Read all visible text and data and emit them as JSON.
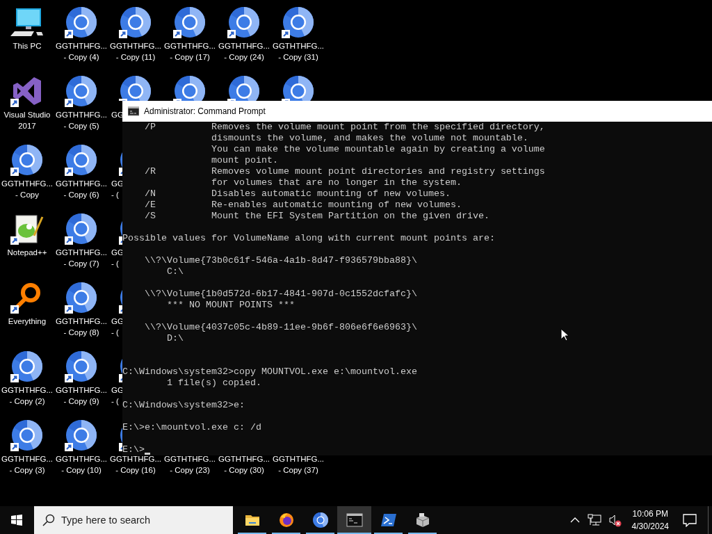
{
  "desktop": {
    "columns": [
      [
        {
          "kind": "pc",
          "lines": [
            "This PC"
          ]
        },
        {
          "kind": "vs",
          "lines": [
            "Visual Studio",
            "2017"
          ]
        },
        {
          "kind": "ring",
          "lines": [
            "GGTHTHFG...",
            "- Copy"
          ]
        },
        {
          "kind": "notepad",
          "lines": [
            "Notepad++"
          ]
        },
        {
          "kind": "everything",
          "lines": [
            "Everything"
          ]
        },
        {
          "kind": "ring",
          "lines": [
            "GGTHTHFG...",
            "- Copy (2)"
          ]
        },
        {
          "kind": "ring",
          "lines": [
            "GGTHTHFG...",
            "- Copy (3)"
          ]
        }
      ],
      [
        {
          "kind": "ring",
          "lines": [
            "GGTHTHFG...",
            "- Copy (4)"
          ]
        },
        {
          "kind": "ring",
          "lines": [
            "GGTHTHFG...",
            "- Copy (5)"
          ]
        },
        {
          "kind": "ring",
          "lines": [
            "GGTHTHFG...",
            "- Copy (6)"
          ]
        },
        {
          "kind": "ring",
          "lines": [
            "GGTHTHFG...",
            "- Copy (7)"
          ]
        },
        {
          "kind": "ring",
          "lines": [
            "GGTHTHFG...",
            "- Copy (8)"
          ]
        },
        {
          "kind": "ring",
          "lines": [
            "GGTHTHFG...",
            "- Copy (9)"
          ]
        },
        {
          "kind": "ring",
          "lines": [
            "GGTHTHFG...",
            "- Copy (10)"
          ]
        }
      ],
      [
        {
          "kind": "ring",
          "lines": [
            "GGTHTHFG...",
            "- Copy (11)"
          ]
        },
        {
          "kind": "ring",
          "lines": [
            "GG"
          ],
          "partial": true
        },
        {
          "kind": "ring",
          "lines": [
            "GG",
            "- ("
          ],
          "partial": true
        },
        {
          "kind": "ring",
          "lines": [
            "GG",
            "- ("
          ],
          "partial": true
        },
        {
          "kind": "ring",
          "lines": [
            "GG",
            "- ("
          ],
          "partial": true
        },
        {
          "kind": "ring",
          "lines": [
            "GG",
            "- ("
          ],
          "partial": true
        },
        {
          "kind": "ring",
          "lines": [
            "GGTHTHFG...",
            "- Copy (16)"
          ]
        }
      ],
      [
        {
          "kind": "ring",
          "lines": [
            "GGTHTHFG...",
            "- Copy (17)"
          ]
        },
        {
          "kind": "ring"
        },
        {
          "kind": "covered"
        },
        {
          "kind": "covered"
        },
        {
          "kind": "covered"
        },
        {
          "kind": "covered"
        },
        {
          "kind": "label_only",
          "lines": [
            "GGTHTHFG...",
            "- Copy (23)"
          ]
        }
      ],
      [
        {
          "kind": "ring",
          "lines": [
            "GGTHTHFG...",
            "- Copy (24)"
          ]
        },
        {
          "kind": "ring"
        },
        {
          "kind": "covered"
        },
        {
          "kind": "covered"
        },
        {
          "kind": "covered"
        },
        {
          "kind": "covered"
        },
        {
          "kind": "label_only",
          "lines": [
            "GGTHTHFG...",
            "- Copy (30)"
          ]
        }
      ],
      [
        {
          "kind": "ring",
          "lines": [
            "GGTHTHFG...",
            "- Copy (31)"
          ]
        },
        {
          "kind": "ring"
        },
        {
          "kind": "covered"
        },
        {
          "kind": "covered"
        },
        {
          "kind": "covered"
        },
        {
          "kind": "covered"
        },
        {
          "kind": "label_only",
          "lines": [
            "GGTHTHFG...",
            "- Copy (37)"
          ]
        }
      ]
    ]
  },
  "window": {
    "title": "Administrator: Command Prompt",
    "lines": [
      {
        "text": "    /P          Removes the volume mount point from the specified directory,"
      },
      {
        "text": "                dismounts the volume, and makes the volume not mountable."
      },
      {
        "text": "                You can make the volume mountable again by creating a volume"
      },
      {
        "text": "                mount point."
      },
      {
        "text": "    /R          Removes volume mount point directories and registry settings"
      },
      {
        "text": "                for volumes that are no longer in the system."
      },
      {
        "text": "    /N          Disables automatic mounting of new volumes."
      },
      {
        "text": "    /E          Re-enables automatic mounting of new volumes."
      },
      {
        "text": "    /S          Mount the EFI System Partition on the given drive."
      },
      {
        "kind": "blank"
      },
      {
        "text": "Possible values for VolumeName along with current mount points are:"
      },
      {
        "kind": "blank"
      },
      {
        "text": "    \\\\?\\Volume{73b0c61f-546a-4a1b-8d47-f936579bba88}\\"
      },
      {
        "text": "        C:\\"
      },
      {
        "kind": "blank"
      },
      {
        "text": "    \\\\?\\Volume{1b0d572d-6b17-4841-907d-0c1552dcfafc}\\"
      },
      {
        "text": "        *** NO MOUNT POINTS ***"
      },
      {
        "kind": "blank"
      },
      {
        "text": "    \\\\?\\Volume{4037c05c-4b89-11ee-9b6f-806e6f6e6963}\\"
      },
      {
        "text": "        D:\\"
      },
      {
        "kind": "blank"
      },
      {
        "kind": "blank"
      },
      {
        "text": "C:\\Windows\\system32>copy MOUNTVOL.exe e:\\mountvol.exe"
      },
      {
        "text": "        1 file(s) copied."
      },
      {
        "kind": "blank"
      },
      {
        "text": "C:\\Windows\\system32>e:"
      },
      {
        "kind": "blank"
      },
      {
        "text": "E:\\>e:\\mountvol.exe c: /d"
      },
      {
        "kind": "blank"
      },
      {
        "text": "E:\\>",
        "cursor": true
      }
    ]
  },
  "taskbar": {
    "search": {
      "placeholder": "Type here to search"
    },
    "apps": [
      {
        "kind": "folder",
        "running": true,
        "selected": false
      },
      {
        "kind": "firefox",
        "running": true,
        "selected": false
      },
      {
        "kind": "ring",
        "running": true,
        "selected": false
      },
      {
        "kind": "terminal",
        "running": true,
        "selected": true
      },
      {
        "kind": "powershell",
        "running": true,
        "selected": false
      },
      {
        "kind": "package",
        "running": true,
        "selected": false
      }
    ],
    "tray": {
      "volume_muted": true,
      "time": "10:06 PM",
      "date": "4/30/2024"
    }
  }
}
